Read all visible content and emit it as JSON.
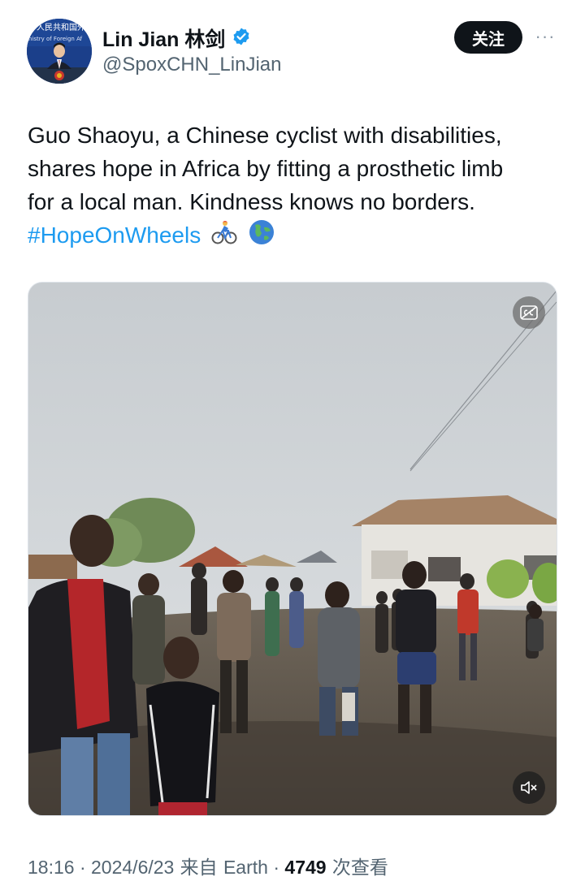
{
  "author": {
    "display_name": "Lin Jian 林剑",
    "handle": "@SpoxCHN_LinJian",
    "verified": true,
    "avatar_banner_text": "华人民共和国外",
    "avatar_banner_text_2": "inistry of Foreign Af"
  },
  "actions": {
    "follow_label": "关注",
    "more_label": "···"
  },
  "tweet": {
    "text_line_1": "Guo Shaoyu, a Chinese cyclist with disabilities,",
    "text_line_2": "shares hope in Africa by fitting a prosthetic limb",
    "text_line_3": "for a local man. Kindness knows no borders.",
    "hashtag": "#HopeOnWheels"
  },
  "media": {
    "type": "video",
    "muted": true,
    "captions_available": true
  },
  "meta": {
    "time": "18:16",
    "sep1": " · ",
    "date": "2024/6/23",
    "source_prefix": " 来自 ",
    "source": "Earth",
    "sep2": " · ",
    "views": "4749",
    "views_suffix": " 次查看"
  },
  "colors": {
    "link": "#1d9bf0",
    "secondary_text": "#536471",
    "follow_button_bg": "#0f1419",
    "verified_badge": "#1d9bf0"
  },
  "icons": [
    "verified-badge-icon",
    "more-options-icon",
    "cyclist-emoji",
    "globe-emoji",
    "closed-captions-icon",
    "mute-icon"
  ]
}
